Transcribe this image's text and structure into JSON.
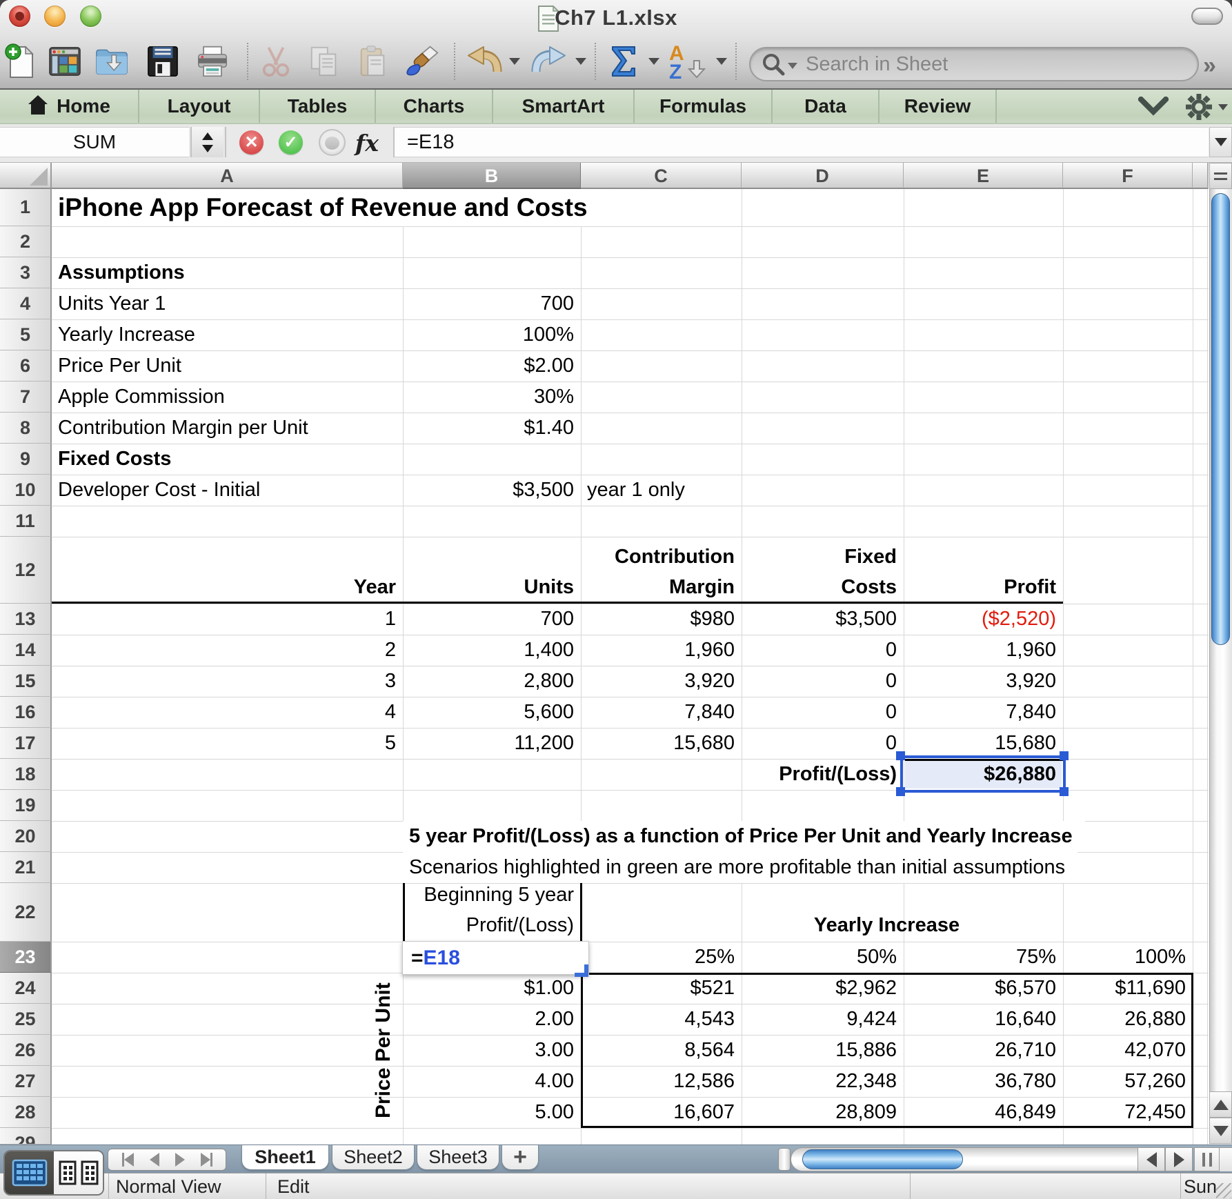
{
  "window": {
    "title": "Ch7 L1.xlsx"
  },
  "toolbar": {
    "search_placeholder": "Search in Sheet",
    "overflow_label": "»"
  },
  "ribbon": {
    "tabs": [
      {
        "label": "Home"
      },
      {
        "label": "Layout"
      },
      {
        "label": "Tables"
      },
      {
        "label": "Charts"
      },
      {
        "label": "SmartArt"
      },
      {
        "label": "Formulas"
      },
      {
        "label": "Data"
      },
      {
        "label": "Review"
      }
    ]
  },
  "formula_bar": {
    "name_box_value": "SUM",
    "fx_label": "fx",
    "formula_value": "=E18"
  },
  "sheet": {
    "columns": [
      "A",
      "B",
      "C",
      "D",
      "E",
      "F"
    ],
    "selected_column": "B",
    "selected_row": "23",
    "vertical_label": "Price Per Unit",
    "edit_cell": {
      "address": "B23",
      "prefix": "=",
      "reference": "E18"
    },
    "selection": {
      "address": "E18",
      "value": "$26,880"
    },
    "cells": [
      {
        "a": "A1",
        "t": "iPhone App Forecast of Revenue and Costs",
        "al": "l",
        "b": 1,
        "spill": 1,
        "size": 37
      },
      {
        "a": "A3",
        "t": "Assumptions",
        "al": "l",
        "b": 1
      },
      {
        "a": "A4",
        "t": "Units Year 1",
        "al": "l"
      },
      {
        "a": "B4",
        "t": "700",
        "al": "r"
      },
      {
        "a": "A5",
        "t": "Yearly Increase",
        "al": "l"
      },
      {
        "a": "B5",
        "t": "100%",
        "al": "r"
      },
      {
        "a": "A6",
        "t": "Price Per Unit",
        "al": "l"
      },
      {
        "a": "B6",
        "t": "$2.00",
        "al": "r"
      },
      {
        "a": "A7",
        "t": "Apple Commission",
        "al": "l"
      },
      {
        "a": "B7",
        "t": "30%",
        "al": "r"
      },
      {
        "a": "A8",
        "t": "Contribution Margin per Unit",
        "al": "l"
      },
      {
        "a": "B8",
        "t": "$1.40",
        "al": "r"
      },
      {
        "a": "A9",
        "t": "Fixed  Costs",
        "al": "l",
        "b": 1
      },
      {
        "a": "A10",
        "t": "Developer Cost - Initial",
        "al": "l"
      },
      {
        "a": "B10",
        "t": "$3,500",
        "al": "r"
      },
      {
        "a": "C10",
        "t": "year 1 only",
        "al": "l"
      },
      {
        "a": "A12",
        "t": "Year",
        "al": "r",
        "b": 1,
        "two": 1
      },
      {
        "a": "B12",
        "t": "Units",
        "al": "r",
        "b": 1,
        "two": 1
      },
      {
        "a": "C12",
        "t": "Contribution\nMargin",
        "al": "r",
        "b": 1,
        "two": 1
      },
      {
        "a": "D12",
        "t": "Fixed\nCosts",
        "al": "r",
        "b": 1,
        "two": 1
      },
      {
        "a": "E12",
        "t": "Profit",
        "al": "r",
        "b": 1,
        "two": 1
      },
      {
        "a": "A13",
        "t": "1",
        "al": "r"
      },
      {
        "a": "B13",
        "t": "700",
        "al": "r"
      },
      {
        "a": "C13",
        "t": "$980",
        "al": "r"
      },
      {
        "a": "D13",
        "t": "$3,500",
        "al": "r"
      },
      {
        "a": "E13",
        "t": "($2,520)",
        "al": "r",
        "color": "red"
      },
      {
        "a": "A14",
        "t": "2",
        "al": "r"
      },
      {
        "a": "B14",
        "t": "1,400",
        "al": "r"
      },
      {
        "a": "C14",
        "t": "1,960",
        "al": "r"
      },
      {
        "a": "D14",
        "t": "0",
        "al": "r"
      },
      {
        "a": "E14",
        "t": "1,960",
        "al": "r"
      },
      {
        "a": "A15",
        "t": "3",
        "al": "r"
      },
      {
        "a": "B15",
        "t": "2,800",
        "al": "r"
      },
      {
        "a": "C15",
        "t": "3,920",
        "al": "r"
      },
      {
        "a": "D15",
        "t": "0",
        "al": "r"
      },
      {
        "a": "E15",
        "t": "3,920",
        "al": "r"
      },
      {
        "a": "A16",
        "t": "4",
        "al": "r"
      },
      {
        "a": "B16",
        "t": "5,600",
        "al": "r"
      },
      {
        "a": "C16",
        "t": "7,840",
        "al": "r"
      },
      {
        "a": "D16",
        "t": "0",
        "al": "r"
      },
      {
        "a": "E16",
        "t": "7,840",
        "al": "r"
      },
      {
        "a": "A17",
        "t": "5",
        "al": "r"
      },
      {
        "a": "B17",
        "t": "11,200",
        "al": "r"
      },
      {
        "a": "C17",
        "t": "15,680",
        "al": "r"
      },
      {
        "a": "D17",
        "t": "0",
        "al": "r"
      },
      {
        "a": "E17",
        "t": "15,680",
        "al": "r"
      },
      {
        "a": "D18",
        "t": "Profit/(Loss)",
        "al": "r",
        "b": 1
      },
      {
        "a": "E18",
        "t": "$26,880",
        "al": "r",
        "b": 1,
        "z": 3
      },
      {
        "a": "B20",
        "t": "5 year Profit/(Loss) as a function of Price Per Unit and Yearly Increase",
        "al": "l",
        "b": 1,
        "spill": 1
      },
      {
        "a": "B21",
        "t": "Scenarios highlighted in green are more profitable than initial assumptions",
        "al": "l",
        "spill": 1
      },
      {
        "a": "B22",
        "t": "Beginning 5 year\nProfit/(Loss)",
        "al": "r",
        "two": 1
      },
      {
        "a": "D22",
        "t": "Yearly Increase",
        "al": "c",
        "b": 1,
        "span": "C:F",
        "two": 1
      },
      {
        "a": "C23",
        "t": "25%",
        "al": "r"
      },
      {
        "a": "D23",
        "t": "50%",
        "al": "r"
      },
      {
        "a": "E23",
        "t": "75%",
        "al": "r"
      },
      {
        "a": "F23",
        "t": "100%",
        "al": "r"
      },
      {
        "a": "B24",
        "t": "$1.00",
        "al": "r"
      },
      {
        "a": "C24",
        "t": "$521",
        "al": "r"
      },
      {
        "a": "D24",
        "t": "$2,962",
        "al": "r"
      },
      {
        "a": "E24",
        "t": "$6,570",
        "al": "r"
      },
      {
        "a": "F24",
        "t": "$11,690",
        "al": "r"
      },
      {
        "a": "B25",
        "t": "2.00",
        "al": "r"
      },
      {
        "a": "C25",
        "t": "4,543",
        "al": "r"
      },
      {
        "a": "D25",
        "t": "9,424",
        "al": "r"
      },
      {
        "a": "E25",
        "t": "16,640",
        "al": "r"
      },
      {
        "a": "F25",
        "t": "26,880",
        "al": "r"
      },
      {
        "a": "B26",
        "t": "3.00",
        "al": "r"
      },
      {
        "a": "C26",
        "t": "8,564",
        "al": "r"
      },
      {
        "a": "D26",
        "t": "15,886",
        "al": "r"
      },
      {
        "a": "E26",
        "t": "26,710",
        "al": "r"
      },
      {
        "a": "F26",
        "t": "42,070",
        "al": "r"
      },
      {
        "a": "B27",
        "t": "4.00",
        "al": "r"
      },
      {
        "a": "C27",
        "t": "12,586",
        "al": "r"
      },
      {
        "a": "D27",
        "t": "22,348",
        "al": "r"
      },
      {
        "a": "E27",
        "t": "36,780",
        "al": "r"
      },
      {
        "a": "F27",
        "t": "57,260",
        "al": "r"
      },
      {
        "a": "B28",
        "t": "5.00",
        "al": "r"
      },
      {
        "a": "C28",
        "t": "16,607",
        "al": "r"
      },
      {
        "a": "D28",
        "t": "28,809",
        "al": "r"
      },
      {
        "a": "E28",
        "t": "46,849",
        "al": "r"
      },
      {
        "a": "F28",
        "t": "72,450",
        "al": "r"
      }
    ]
  },
  "sheet_tabs": {
    "tabs": [
      {
        "label": "Sheet1",
        "active": true
      },
      {
        "label": "Sheet2",
        "active": false
      },
      {
        "label": "Sheet3",
        "active": false
      }
    ],
    "add_label": "+"
  },
  "status_bar": {
    "view_mode": "Normal View",
    "edit_mode": "Edit",
    "day": "Sun"
  }
}
